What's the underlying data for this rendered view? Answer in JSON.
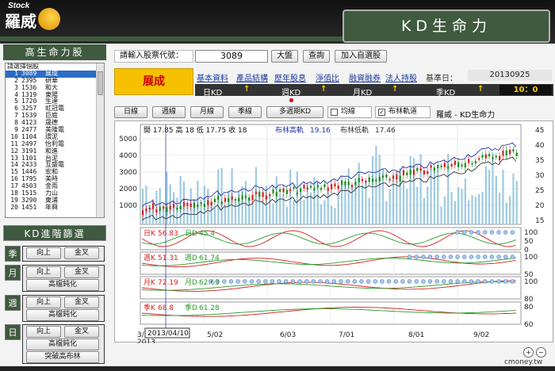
{
  "header": {
    "logo_small": "Stock",
    "logo_brand": "羅威",
    "title": "KD生命力"
  },
  "left": {
    "title": "高生命力股",
    "list_header": "請選擇個股",
    "stocks": [
      {
        "rank": "1",
        "code": "3089",
        "name": "展成"
      },
      {
        "rank": "2",
        "code": "2395",
        "name": "研華"
      },
      {
        "rank": "3",
        "code": "1536",
        "name": "和大"
      },
      {
        "rank": "4",
        "code": "1319",
        "name": "東陽"
      },
      {
        "rank": "5",
        "code": "1720",
        "name": "生達"
      },
      {
        "rank": "6",
        "code": "3257",
        "name": "虹冠電"
      },
      {
        "rank": "7",
        "code": "1539",
        "name": "巨庭"
      },
      {
        "rank": "8",
        "code": "4123",
        "name": "晟德"
      },
      {
        "rank": "9",
        "code": "2477",
        "name": "美隆電"
      },
      {
        "rank": "10",
        "code": "1104",
        "name": "環泥"
      },
      {
        "rank": "11",
        "code": "2497",
        "name": "怡利電"
      },
      {
        "rank": "12",
        "code": "3191",
        "name": "和進"
      },
      {
        "rank": "13",
        "code": "1101",
        "name": "台泥"
      },
      {
        "rank": "14",
        "code": "2433",
        "name": "互盛電"
      },
      {
        "rank": "15",
        "code": "1446",
        "name": "宏和"
      },
      {
        "rank": "16",
        "code": "1795",
        "name": "美時"
      },
      {
        "rank": "17",
        "code": "4503",
        "name": "金雨"
      },
      {
        "rank": "18",
        "code": "1515",
        "name": "力山"
      },
      {
        "rank": "19",
        "code": "3290",
        "name": "東浦"
      },
      {
        "rank": "20",
        "code": "1451",
        "name": "年興"
      }
    ],
    "adv_title": "KD進階篩選",
    "sections": [
      {
        "tag": "季",
        "buttons": [
          "向上",
          "金叉"
        ]
      },
      {
        "tag": "月",
        "buttons": [
          "向上",
          "金叉",
          "高檔鈍化"
        ]
      },
      {
        "tag": "週",
        "buttons": [
          "向上",
          "金叉",
          "高檔鈍化"
        ]
      },
      {
        "tag": "日",
        "buttons": [
          "向上",
          "金叉",
          "高檔鈍化",
          "突破高布林"
        ]
      }
    ]
  },
  "input": {
    "label": "請輸入股票代號：",
    "code": "3089",
    "btn_market": "大盤",
    "btn_query": "查詢",
    "btn_add": "加入自選股"
  },
  "info": {
    "stock_name": "展成",
    "links": [
      "基本資料",
      "產品結構",
      "歷年股息",
      "淨值比",
      "融資融券",
      "法人持股"
    ],
    "base_date_label": "基準日：",
    "base_date": "20130925",
    "kd_labels": [
      "日KD",
      "週KD",
      "月KD",
      "季KD"
    ],
    "arrow": "↑",
    "score": "10：0"
  },
  "tabs": {
    "items": [
      "日線",
      "週線",
      "月線",
      "季線",
      "多週期KD"
    ],
    "chk_ma": "均線",
    "chk_boll": "布林軌道",
    "chart_title": "羅威 - KD生命力"
  },
  "chart_data": {
    "type": "line",
    "price_info": "開 17.85  高 18  低 17.75  收 18",
    "boll_high_label": "布林高軌",
    "boll_high": "19.16",
    "boll_low_label": "布林低軌",
    "boll_low": "17.46",
    "volume_ticks": [
      "5000",
      "4000",
      "3000",
      "2000",
      "1000"
    ],
    "price_ticks": [
      "45",
      "40",
      "35",
      "30",
      "25",
      "20",
      "15"
    ],
    "x_ticks": [
      "3/",
      "5/02",
      "6/03",
      "7/01",
      "8/01",
      "9/02"
    ],
    "x_year": "2013",
    "cursor_date": "2013/04/10",
    "panels": [
      {
        "k_label": "日K",
        "k": "56.83",
        "d_label": "日D",
        "d": "45.4",
        "ticks": [
          "100",
          "50",
          "0"
        ]
      },
      {
        "k_label": "週K",
        "k": "51.31",
        "d_label": "週D",
        "d": "61.74",
        "ticks": [
          "100",
          "50"
        ]
      },
      {
        "k_label": "月K",
        "k": "72.19",
        "d_label": "月D",
        "d": "62.63",
        "ticks": [
          "100",
          "80"
        ]
      },
      {
        "k_label": "季K",
        "k": "68.8",
        "d_label": "季D",
        "d": "61.28",
        "ticks": [
          "80",
          "60"
        ]
      }
    ],
    "colors": {
      "k": "#d42020",
      "d": "#2a9a2a",
      "volume": "#9ecae1",
      "boll_high": "#2233aa",
      "boll_low": "#333333",
      "up": "#d42020",
      "down": "#1f8a1f"
    }
  },
  "footer": {
    "brand": "cmoney.tw"
  }
}
